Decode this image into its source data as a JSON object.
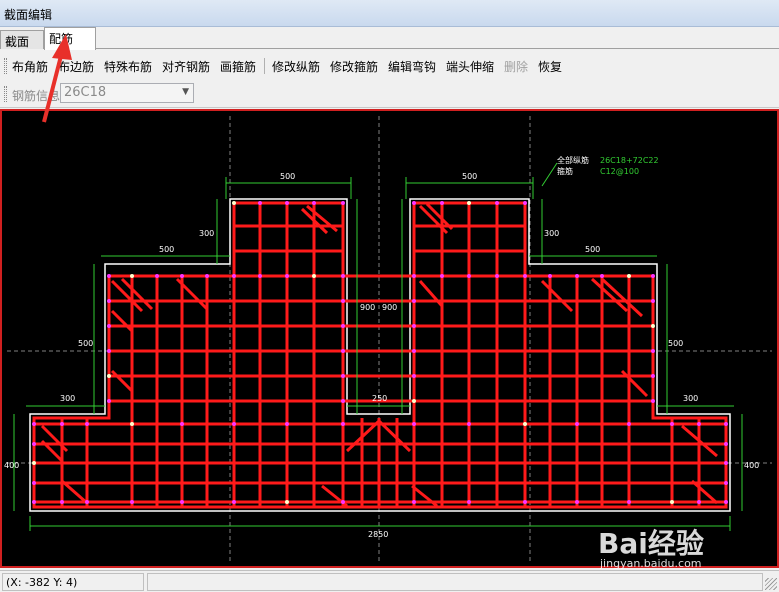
{
  "window": {
    "title": "截面编辑"
  },
  "tabs": [
    {
      "label": "截面"
    },
    {
      "label": "配筋"
    }
  ],
  "toolbar": {
    "buttons": [
      {
        "label": "布角筋"
      },
      {
        "label": "布边筋"
      },
      {
        "label": "特殊布筋"
      },
      {
        "label": "对齐钢筋"
      },
      {
        "label": "画箍筋"
      },
      {
        "label": "修改纵筋"
      },
      {
        "label": "修改箍筋"
      },
      {
        "label": "编辑弯钩"
      },
      {
        "label": "端头伸缩"
      },
      {
        "label": "删除"
      },
      {
        "label": "恢复"
      }
    ]
  },
  "rebar_info": {
    "label": "钢筋信息",
    "value": "26C18"
  },
  "drawing": {
    "legend_all_rebar_label": "全部纵筋",
    "legend_all_rebar_value": "26C18+72C22",
    "legend_stirrup_label": "箍筋",
    "legend_stirrup_value": "C12@100",
    "dims": {
      "top_left_width": "500",
      "top_right_width": "500",
      "left_step_width": "500",
      "right_step_width": "500",
      "left_step_height": "300",
      "right_step_height": "300",
      "left_mid_height": "500",
      "right_mid_height": "500",
      "left_flange": "300",
      "right_flange": "300",
      "left_bottom_height": "400",
      "right_bottom_height": "400",
      "gap_width": "250",
      "gap_left_height": "900",
      "gap_right_height": "900",
      "total_width": "2850"
    },
    "colors": {
      "rebar": "#ff1a1a",
      "dim": "#32cd32",
      "outline": "#ffffff",
      "bar_dot": "#ff33ff"
    }
  },
  "status": {
    "coords": "(X: -382 Y: 4)"
  },
  "watermark": {
    "brand": "Bai经验",
    "url": "jingyan.baidu.com"
  }
}
